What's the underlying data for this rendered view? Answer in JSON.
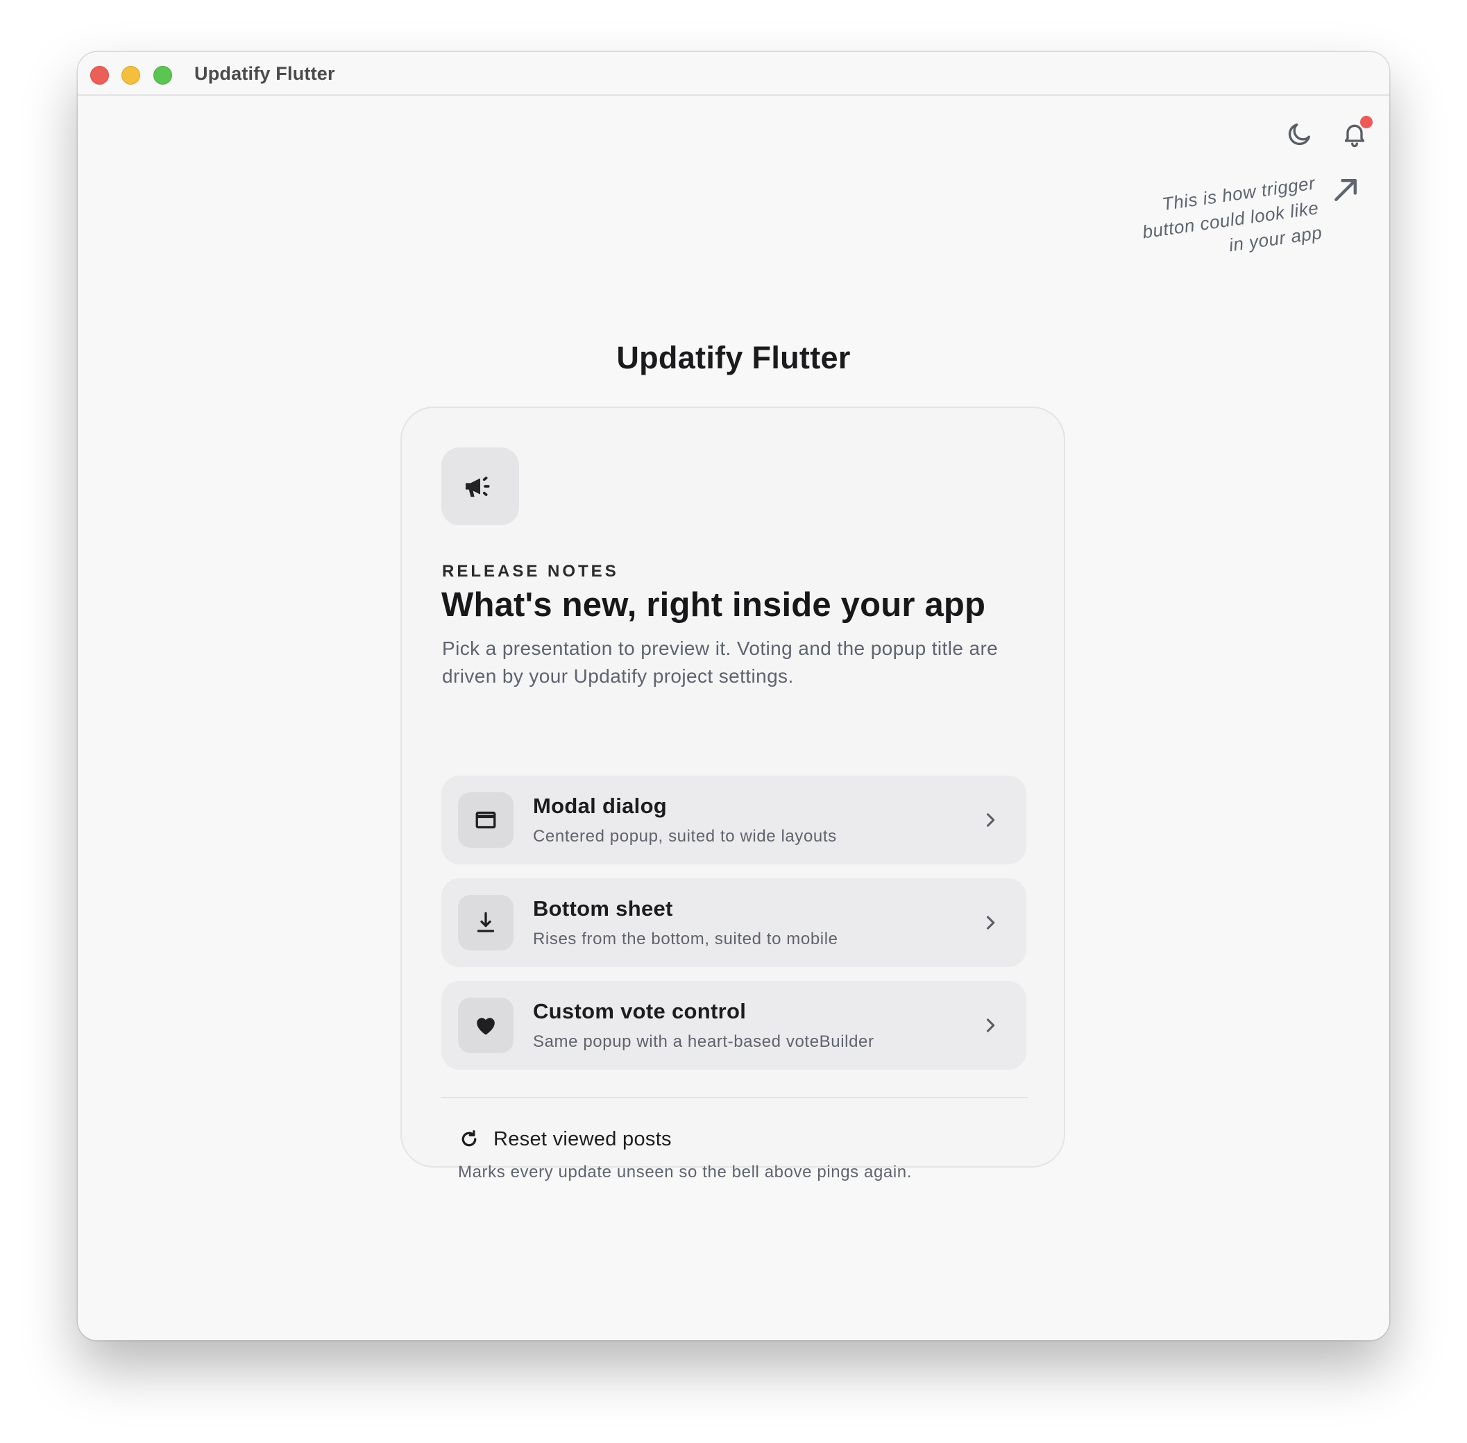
{
  "window": {
    "title": "Updatify Flutter"
  },
  "toolbar": {
    "theme_icon": "moon-icon",
    "notifications_icon": "bell-icon",
    "hint_lines": [
      "This is how trigger",
      "button could look like",
      "in your app"
    ]
  },
  "page": {
    "heading": "Updatify Flutter"
  },
  "card": {
    "icon": "megaphone-icon",
    "eyebrow": "RELEASE NOTES",
    "title": "What's new, right inside your app",
    "description": "Pick a presentation to preview it. Voting and the popup title are driven by your Updatify project settings.",
    "options": [
      {
        "title": "Modal dialog",
        "subtitle": "Centered popup, suited to wide layouts",
        "icon": "window-icon"
      },
      {
        "title": "Bottom sheet",
        "subtitle": "Rises from the bottom, suited to mobile",
        "icon": "download-icon"
      },
      {
        "title": "Custom vote control",
        "subtitle": "Same popup with a heart-based voteBuilder",
        "icon": "heart-icon"
      }
    ],
    "reset": {
      "label": "Reset viewed posts",
      "hint": "Marks every update unseen so the bell above pings again.",
      "icon": "refresh-icon"
    }
  },
  "colors": {
    "window_bg": "#f8f8f8",
    "card_bg": "#f5f5f6",
    "option_bg": "#ebebed",
    "badge_red": "#ec5a5a",
    "text_primary": "#1b1b1d",
    "text_secondary": "#5f6370"
  }
}
